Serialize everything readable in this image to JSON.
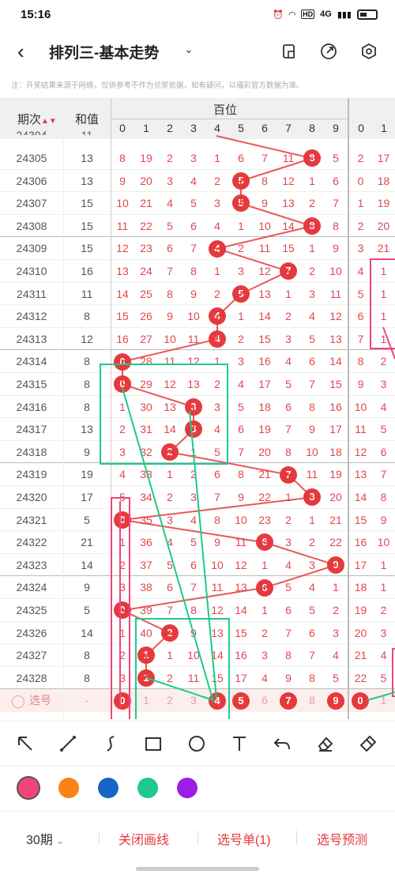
{
  "status": {
    "time": "15:16",
    "network": "4G",
    "hd": "HD"
  },
  "nav": {
    "title": "排列三-基本走势"
  },
  "notice": "注：开奖结果来源于网络，仅供参考不作为兑奖依据，如有疑问，以福彩官方数据为准。",
  "table": {
    "col_period": "期次",
    "col_sum": "和值",
    "group_title": "百位",
    "digits": [
      "0",
      "1",
      "2",
      "3",
      "4",
      "5",
      "6",
      "7",
      "8",
      "9"
    ],
    "next_digits": [
      "0",
      "1"
    ],
    "rows": [
      {
        "period": "24305",
        "sum": "13",
        "cells": [
          "8",
          "19",
          "2",
          "3",
          "1",
          "6",
          "7",
          "11",
          "8",
          "5"
        ],
        "hit": 8,
        "next": [
          "2",
          "17"
        ]
      },
      {
        "period": "24306",
        "sum": "13",
        "cells": [
          "9",
          "20",
          "3",
          "4",
          "2",
          "5",
          "8",
          "12",
          "1",
          "6"
        ],
        "hit": 5,
        "next": [
          "0",
          "18"
        ]
      },
      {
        "period": "24307",
        "sum": "15",
        "cells": [
          "10",
          "21",
          "4",
          "5",
          "3",
          "5",
          "9",
          "13",
          "2",
          "7"
        ],
        "hit": 5,
        "next": [
          "1",
          "19"
        ]
      },
      {
        "period": "24308",
        "sum": "15",
        "cells": [
          "11",
          "22",
          "5",
          "6",
          "4",
          "1",
          "10",
          "14",
          "8",
          "8"
        ],
        "hit": 8,
        "next": [
          "2",
          "20"
        ]
      },
      {
        "period": "24309",
        "sum": "15",
        "cells": [
          "12",
          "23",
          "6",
          "7",
          "4",
          "2",
          "11",
          "15",
          "1",
          "9"
        ],
        "hit": 4,
        "next": [
          "3",
          "21"
        ]
      },
      {
        "period": "24310",
        "sum": "16",
        "cells": [
          "13",
          "24",
          "7",
          "8",
          "1",
          "3",
          "12",
          "7",
          "2",
          "10"
        ],
        "hit": 7,
        "next": [
          "4",
          "1"
        ]
      },
      {
        "period": "24311",
        "sum": "11",
        "cells": [
          "14",
          "25",
          "8",
          "9",
          "2",
          "5",
          "13",
          "1",
          "3",
          "11"
        ],
        "hit": 5,
        "next": [
          "5",
          "1"
        ]
      },
      {
        "period": "24312",
        "sum": "8",
        "cells": [
          "15",
          "26",
          "9",
          "10",
          "4",
          "1",
          "14",
          "2",
          "4",
          "12"
        ],
        "hit": 4,
        "next": [
          "6",
          "1"
        ]
      },
      {
        "period": "24313",
        "sum": "12",
        "cells": [
          "16",
          "27",
          "10",
          "11",
          "4",
          "2",
          "15",
          "3",
          "5",
          "13"
        ],
        "hit": 4,
        "next": [
          "7",
          "1"
        ]
      },
      {
        "period": "24314",
        "sum": "8",
        "cells": [
          "0",
          "28",
          "11",
          "12",
          "1",
          "3",
          "16",
          "4",
          "6",
          "14"
        ],
        "hit": 0,
        "next": [
          "8",
          "2"
        ]
      },
      {
        "period": "24315",
        "sum": "8",
        "cells": [
          "0",
          "29",
          "12",
          "13",
          "2",
          "4",
          "17",
          "5",
          "7",
          "15"
        ],
        "hit": 0,
        "next": [
          "9",
          "3"
        ]
      },
      {
        "period": "24316",
        "sum": "8",
        "cells": [
          "1",
          "30",
          "13",
          "3",
          "3",
          "5",
          "18",
          "6",
          "8",
          "16"
        ],
        "hit": 3,
        "next": [
          "10",
          "4"
        ]
      },
      {
        "period": "24317",
        "sum": "13",
        "cells": [
          "2",
          "31",
          "14",
          "3",
          "4",
          "6",
          "19",
          "7",
          "9",
          "17"
        ],
        "hit": 3,
        "next": [
          "11",
          "5"
        ]
      },
      {
        "period": "24318",
        "sum": "9",
        "cells": [
          "3",
          "32",
          "2",
          "1",
          "5",
          "7",
          "20",
          "8",
          "10",
          "18"
        ],
        "hit": 2,
        "next": [
          "12",
          "6"
        ]
      },
      {
        "period": "24319",
        "sum": "19",
        "cells": [
          "4",
          "33",
          "1",
          "2",
          "6",
          "8",
          "21",
          "7",
          "11",
          "19"
        ],
        "hit": 7,
        "next": [
          "13",
          "7"
        ]
      },
      {
        "period": "24320",
        "sum": "17",
        "cells": [
          "5",
          "34",
          "2",
          "3",
          "7",
          "9",
          "22",
          "1",
          "8",
          "20"
        ],
        "hit": 8,
        "next": [
          "14",
          "8"
        ]
      },
      {
        "period": "24321",
        "sum": "5",
        "cells": [
          "0",
          "35",
          "3",
          "4",
          "8",
          "10",
          "23",
          "2",
          "1",
          "21"
        ],
        "hit": 0,
        "next": [
          "15",
          "9"
        ]
      },
      {
        "period": "24322",
        "sum": "21",
        "cells": [
          "1",
          "36",
          "4",
          "5",
          "9",
          "11",
          "6",
          "3",
          "2",
          "22"
        ],
        "hit": 6,
        "next": [
          "16",
          "10"
        ]
      },
      {
        "period": "24323",
        "sum": "14",
        "cells": [
          "2",
          "37",
          "5",
          "6",
          "10",
          "12",
          "1",
          "4",
          "3",
          "9"
        ],
        "hit": 9,
        "next": [
          "17",
          "1"
        ]
      },
      {
        "period": "24324",
        "sum": "9",
        "cells": [
          "3",
          "38",
          "6",
          "7",
          "11",
          "13",
          "6",
          "5",
          "4",
          "1"
        ],
        "hit": 6,
        "next": [
          "18",
          "1"
        ]
      },
      {
        "period": "24325",
        "sum": "5",
        "cells": [
          "0",
          "39",
          "7",
          "8",
          "12",
          "14",
          "1",
          "6",
          "5",
          "2"
        ],
        "hit": 0,
        "next": [
          "19",
          "2"
        ]
      },
      {
        "period": "24326",
        "sum": "14",
        "cells": [
          "1",
          "40",
          "2",
          "9",
          "13",
          "15",
          "2",
          "7",
          "6",
          "3"
        ],
        "hit": 2,
        "next": [
          "20",
          "3"
        ]
      },
      {
        "period": "24327",
        "sum": "8",
        "cells": [
          "2",
          "1",
          "1",
          "10",
          "14",
          "16",
          "3",
          "8",
          "7",
          "4"
        ],
        "hit": 1,
        "next": [
          "21",
          "4"
        ]
      },
      {
        "period": "24328",
        "sum": "8",
        "cells": [
          "3",
          "1",
          "2",
          "11",
          "15",
          "17",
          "4",
          "9",
          "8",
          "5"
        ],
        "hit": 1,
        "next": [
          "22",
          "5"
        ]
      }
    ],
    "partial_top": {
      "period": "24304",
      "sum": "11"
    },
    "select_row": {
      "label": "选号",
      "sum": "-",
      "cells": [
        "0",
        "1",
        "2",
        "3",
        "4",
        "5",
        "6",
        "7",
        "8",
        "9"
      ],
      "selected": [
        0,
        4,
        5,
        7,
        9
      ],
      "next": [
        "0",
        "1"
      ]
    }
  },
  "tools": [
    "arrow-tool",
    "line-tool",
    "curve-tool",
    "rect-tool",
    "circle-tool",
    "text-tool",
    "undo-tool",
    "eraser-tool",
    "clear-tool"
  ],
  "colors": [
    "#f0457a",
    "#fb8214",
    "#1a64c8",
    "#1ec98d",
    "#9b1de8"
  ],
  "bottom": {
    "periods": "30期",
    "close_draw": "关闭画线",
    "select_list": "选号单(1)",
    "predict": "选号预测"
  }
}
